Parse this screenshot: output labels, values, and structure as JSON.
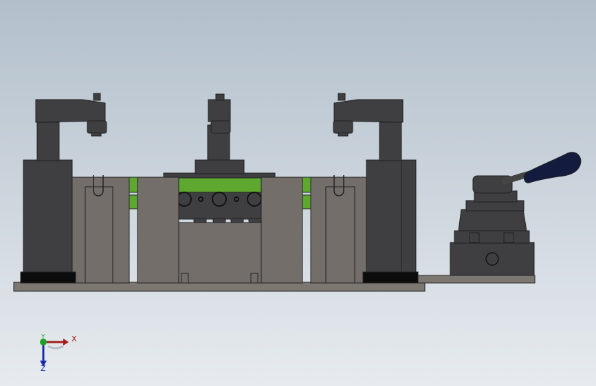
{
  "viewport": {
    "background_top": "#b2bfcb",
    "background_bottom": "#e7ebef"
  },
  "model": {
    "colors": {
      "base_plate": "#7d7772",
      "fixture_gray": "#736e6a",
      "dark_metal": "#3f3f41",
      "green_plate": "#5fa830",
      "rubber_pad": "#0c0c0d",
      "handle_knob": "#131c3e"
    }
  },
  "triad": {
    "x_label": "X",
    "y_label": "Y",
    "z_label": "Z",
    "x_color": "#a31c1c",
    "y_color": "#1f9f2b",
    "z_color": "#1c2aa6"
  }
}
